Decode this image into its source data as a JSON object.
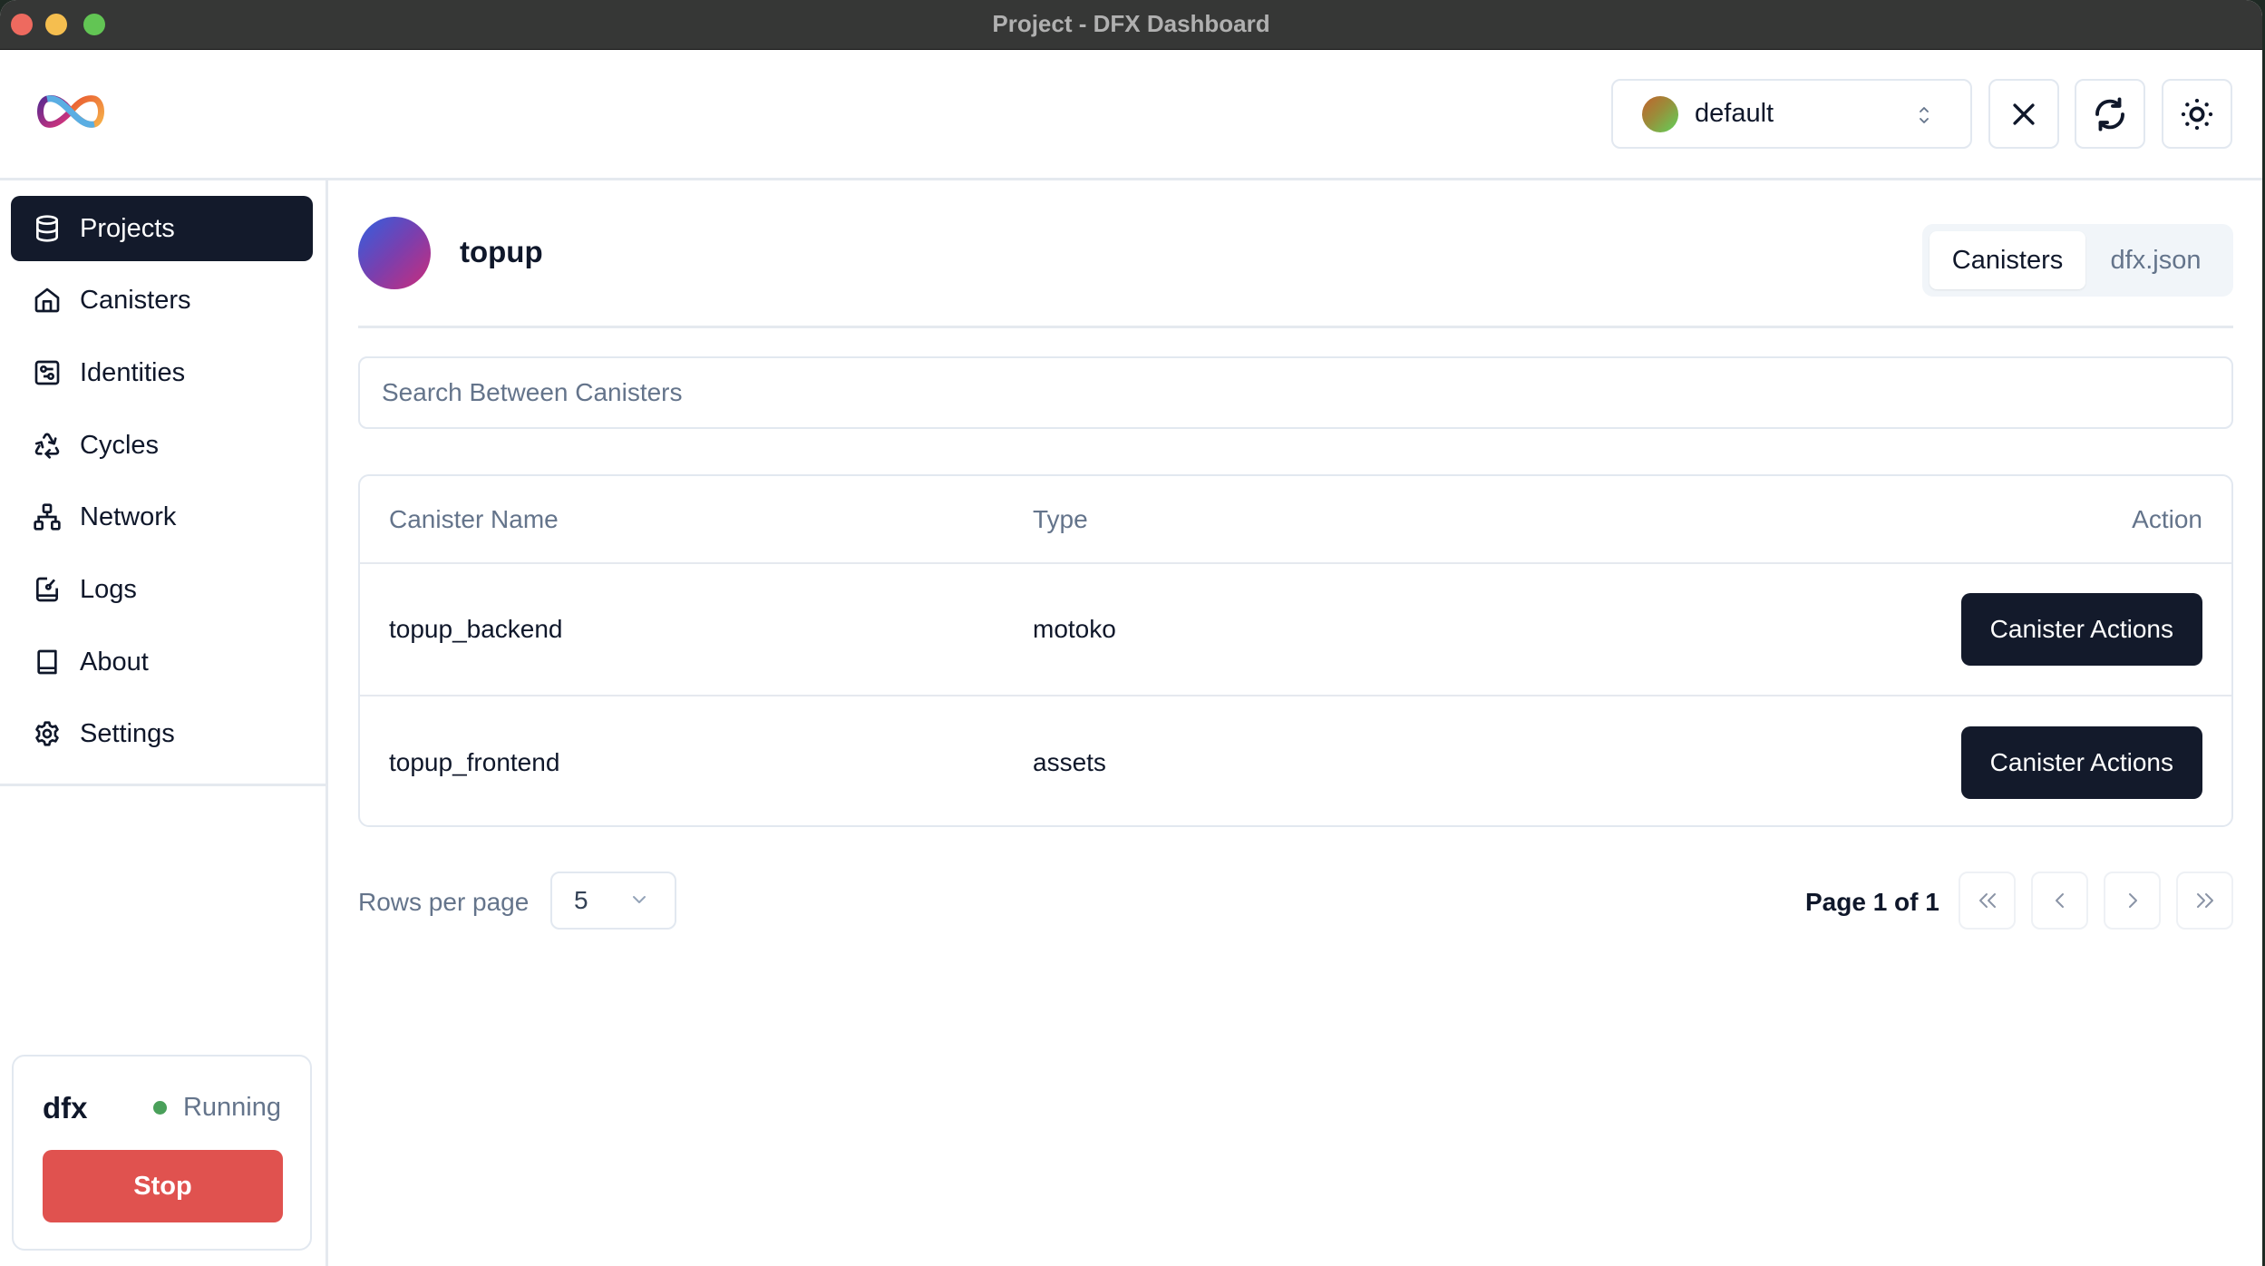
{
  "window": {
    "title": "Project - DFX Dashboard"
  },
  "header": {
    "logo": "internet-computer-infinity-logo",
    "identity": {
      "selected": "default"
    },
    "buttons": {
      "close": "close-icon",
      "refresh": "refresh-icon",
      "theme": "sun-icon"
    }
  },
  "sidebar": {
    "items": [
      {
        "label": "Projects",
        "icon": "database-icon",
        "active": true
      },
      {
        "label": "Canisters",
        "icon": "home-icon",
        "active": false
      },
      {
        "label": "Identities",
        "icon": "identity-icon",
        "active": false
      },
      {
        "label": "Cycles",
        "icon": "recycle-icon",
        "active": false
      },
      {
        "label": "Network",
        "icon": "network-icon",
        "active": false
      },
      {
        "label": "Logs",
        "icon": "logs-icon",
        "active": false
      },
      {
        "label": "About",
        "icon": "book-icon",
        "active": false
      },
      {
        "label": "Settings",
        "icon": "gear-icon",
        "active": false
      }
    ],
    "dfx": {
      "name": "dfx",
      "status": "Running",
      "status_color": "#4aa05a",
      "stop_label": "Stop"
    }
  },
  "main": {
    "project_name": "topup",
    "tabs": [
      {
        "label": "Canisters",
        "active": true
      },
      {
        "label": "dfx.json",
        "active": false
      }
    ],
    "search": {
      "placeholder": "Search Between Canisters",
      "value": ""
    },
    "table": {
      "headers": [
        "Canister Name",
        "Type",
        "Action"
      ],
      "rows": [
        {
          "name": "topup_backend",
          "type": "motoko",
          "action": "Canister Actions"
        },
        {
          "name": "topup_frontend",
          "type": "assets",
          "action": "Canister Actions"
        }
      ]
    },
    "pagination": {
      "rows_per_page_label": "Rows per page",
      "rows_per_page": "5",
      "page_label": "Page 1 of 1"
    }
  },
  "colors": {
    "accent_dark": "#131a2b",
    "danger": "#e0524f",
    "muted": "#64748b"
  }
}
